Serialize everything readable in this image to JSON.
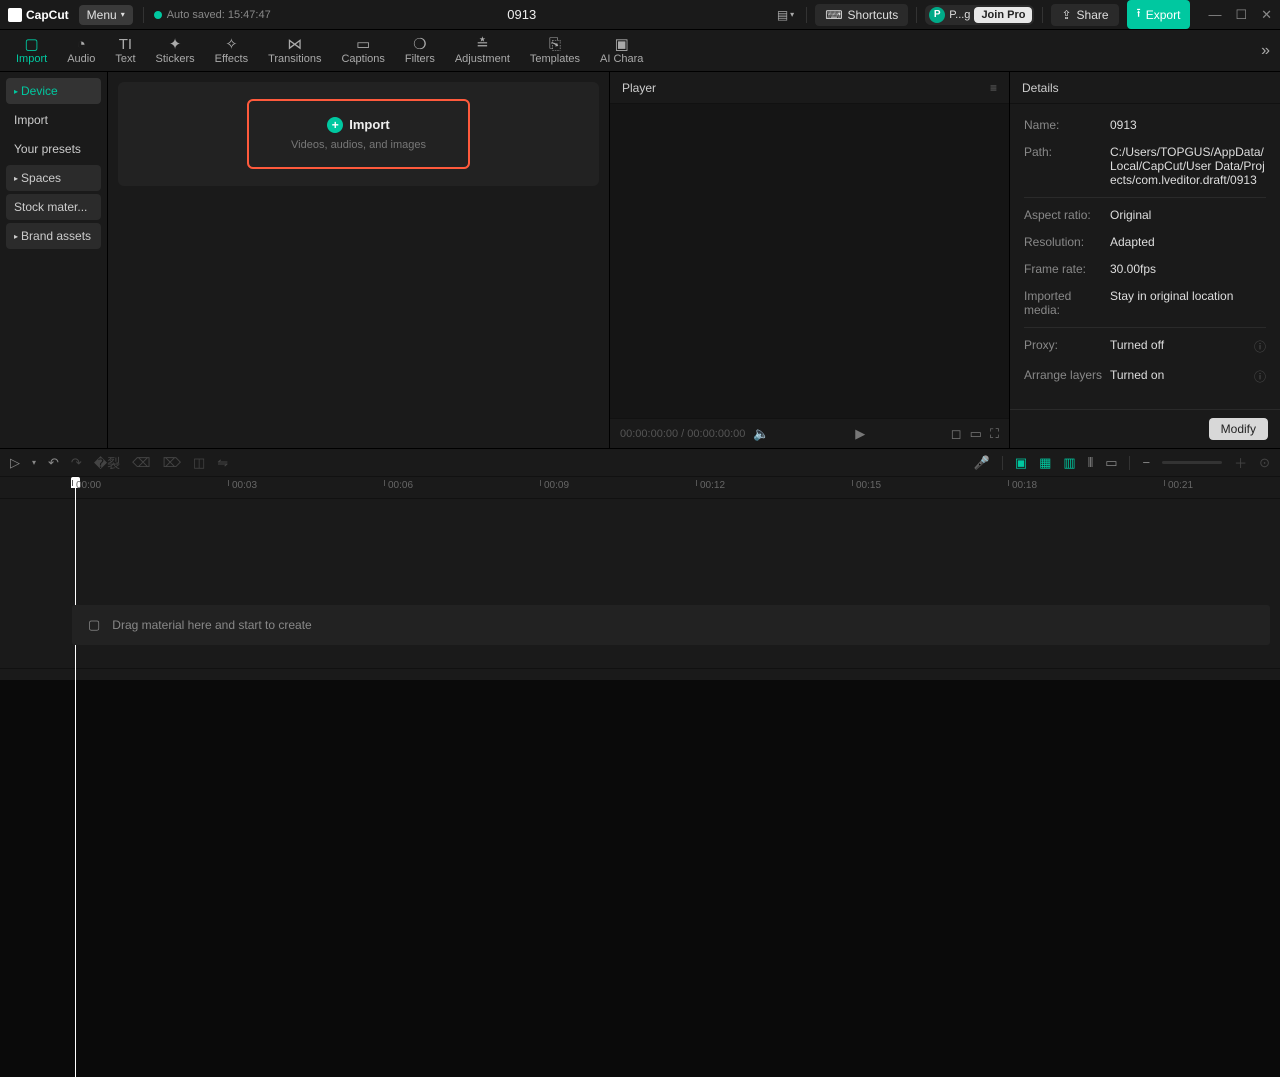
{
  "app": {
    "name": "CapCut",
    "menu_label": "Menu",
    "autosave": "Auto saved: 15:47:47",
    "project_title": "0913"
  },
  "titlebar": {
    "shortcuts": "Shortcuts",
    "user_short": "P...g",
    "join_pro": "Join Pro",
    "share": "Share",
    "export": "Export"
  },
  "tabs": [
    {
      "label": "Import",
      "icon": "▢",
      "active": true
    },
    {
      "label": "Audio",
      "icon": "◔"
    },
    {
      "label": "Text",
      "icon": "TI"
    },
    {
      "label": "Stickers",
      "icon": "✦"
    },
    {
      "label": "Effects",
      "icon": "✧"
    },
    {
      "label": "Transitions",
      "icon": "⋈"
    },
    {
      "label": "Captions",
      "icon": "▭"
    },
    {
      "label": "Filters",
      "icon": "❍"
    },
    {
      "label": "Adjustment",
      "icon": "≛"
    },
    {
      "label": "Templates",
      "icon": "⎘"
    },
    {
      "label": "AI Chara",
      "icon": "▣"
    }
  ],
  "sidebar": {
    "items": [
      {
        "label": "Device",
        "active": true,
        "caret": true
      },
      {
        "label": "Import"
      },
      {
        "label": "Your presets"
      },
      {
        "label": "Spaces",
        "caret": true,
        "sub": true
      },
      {
        "label": "Stock mater...",
        "sub": true
      },
      {
        "label": "Brand assets",
        "caret": true,
        "sub": true
      }
    ]
  },
  "import_box": {
    "title": "Import",
    "subtitle": "Videos, audios, and images"
  },
  "player": {
    "title": "Player",
    "time": "00:00:00:00 / 00:00:00:00"
  },
  "details": {
    "title": "Details",
    "rows": {
      "name_k": "Name:",
      "name_v": "0913",
      "path_k": "Path:",
      "path_v": "C:/Users/TOPGUS/AppData/Local/CapCut/User Data/Projects/com.lveditor.draft/0913",
      "aspect_k": "Aspect ratio:",
      "aspect_v": "Original",
      "res_k": "Resolution:",
      "res_v": "Adapted",
      "fps_k": "Frame rate:",
      "fps_v": "30.00fps",
      "imp_k": "Imported media:",
      "imp_v": "Stay in original location",
      "proxy_k": "Proxy:",
      "proxy_v": "Turned off",
      "layers_k": "Arrange layers",
      "layers_v": "Turned on"
    },
    "modify": "Modify"
  },
  "timeline": {
    "ticks": [
      "00:00",
      "00:03",
      "00:06",
      "00:09",
      "00:12",
      "00:15",
      "00:18",
      "00:21"
    ],
    "drop_hint": "Drag material here and start to create"
  }
}
